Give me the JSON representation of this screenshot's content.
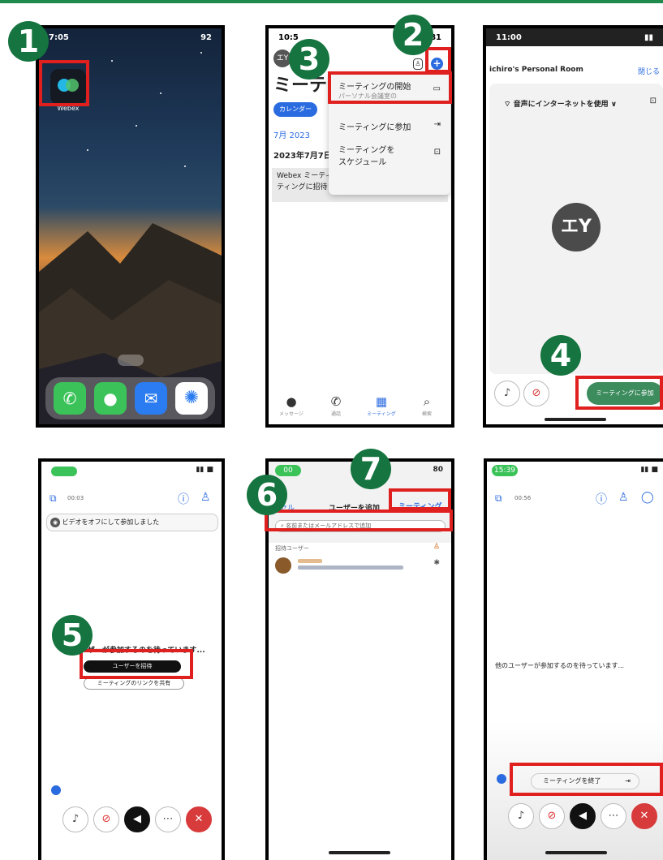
{
  "s1": {
    "time": "7:05",
    "status": "92",
    "app_label": "Webex"
  },
  "s2": {
    "time": "10:5",
    "battery": "81",
    "avatar": "エY",
    "title": "ミーテ",
    "calendar_btn": "カレンダー",
    "month": "7月 2023",
    "date": "2023年7月7日",
    "empty": "Webex ミーティングをスケジュールしたり、ミーティングに招待されたりすると、ここに表",
    "menu": {
      "start_title": "ミーティングの開始",
      "start_sub": "パーソナル会議室の",
      "join": "ミーティングに参加",
      "schedule_l1": "ミーティングを",
      "schedule_l2": "スケジュール"
    },
    "nav": [
      "メッセージ",
      "通話",
      "ミーティング",
      "検索"
    ]
  },
  "s3": {
    "time": "11:00",
    "room": "ichiro's Personal Room",
    "close": "閉じる",
    "audio": "音声にインターネットを使用",
    "initials": "エY",
    "join_btn": "ミーティングに参加"
  },
  "s4": {
    "timer": "00:03",
    "notice": "ビデオをオフにして参加しました",
    "waiting": "ーザーが参加するのを待っています...",
    "invite_btn": "ユーザーを招待",
    "share_btn": "ミーティングのリンクを共有"
  },
  "s5": {
    "time": "00",
    "back": "セル",
    "title": "ユーザーを追加",
    "tab": "ミーティング",
    "search_placeholder": "名前またはメールアドレスで追加",
    "section": "招待ユーザー",
    "battery": "80"
  },
  "s6": {
    "time": "15:39",
    "timer": "00:56",
    "waiting": "他のユーザーが参加するのを待っています...",
    "end_btn": "ミーティングを終了"
  },
  "steps": [
    "1",
    "2",
    "3",
    "4",
    "5",
    "6",
    "7"
  ]
}
